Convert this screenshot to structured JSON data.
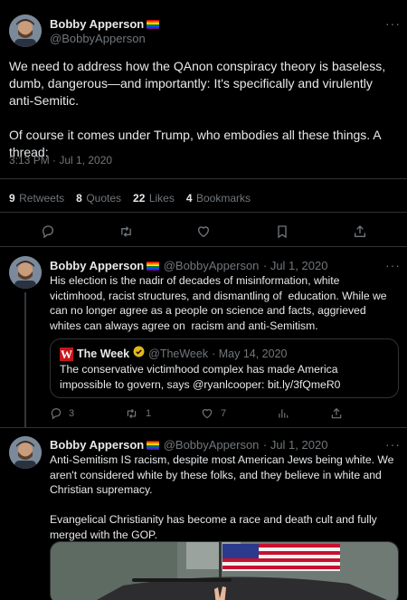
{
  "main_tweet": {
    "author_name": "Bobby Apperson",
    "author_handle": "@BobbyApperson",
    "text": "We need to address how the QAnon conspiracy theory is baseless, dumb, dangerous—and importantly: It's specifically and virulently anti-Semitic.\n\nOf course it comes under Trump, who embodies all these things. A thread:",
    "timestamp": "3:13 PM · Jul 1, 2020",
    "stats": [
      {
        "num": "9",
        "label": "Retweets"
      },
      {
        "num": "8",
        "label": "Quotes"
      },
      {
        "num": "22",
        "label": "Likes"
      },
      {
        "num": "4",
        "label": "Bookmarks"
      }
    ],
    "actions": [
      "reply-icon",
      "retweet-icon",
      "like-icon",
      "bookmark-icon",
      "share-icon"
    ]
  },
  "reply1": {
    "author_name": "Bobby Apperson",
    "author_handle": "@BobbyApperson",
    "date": "· Jul 1, 2020",
    "text": "His election is the nadir of decades of misinformation, white victimhood, racist structures, and dismantling of  education. While we can no longer agree as a people on science and facts, aggrieved whites can always agree on  racism and anti-Semitism.",
    "quote": {
      "logo_letter": "W",
      "name": "The Week",
      "handle": "@TheWeek",
      "date": "· May 14, 2020",
      "text": "The conservative victimhood complex has made America impossible to govern, says @ryanlcooper: bit.ly/3fQmeR0"
    },
    "counts": {
      "reply": "3",
      "retweet": "1",
      "like": "7"
    }
  },
  "reply2": {
    "author_name": "Bobby Apperson",
    "author_handle": "@BobbyApperson",
    "date": "· Jul 1, 2020",
    "text": "Anti-Semitism IS racism, despite most American Jews being white. We aren't considered white by these folks, and they believe in white and Christian supremacy.\n\nEvangelical Christianity has become a race and death cult and fully merged with the GOP."
  },
  "more_glyph": "···",
  "colors": {
    "background": "#000000",
    "text": "#e7e9ea",
    "muted": "#71767b",
    "divider": "#2f3336",
    "verified_gold": "#e2b719",
    "week_red": "#c4161c"
  }
}
